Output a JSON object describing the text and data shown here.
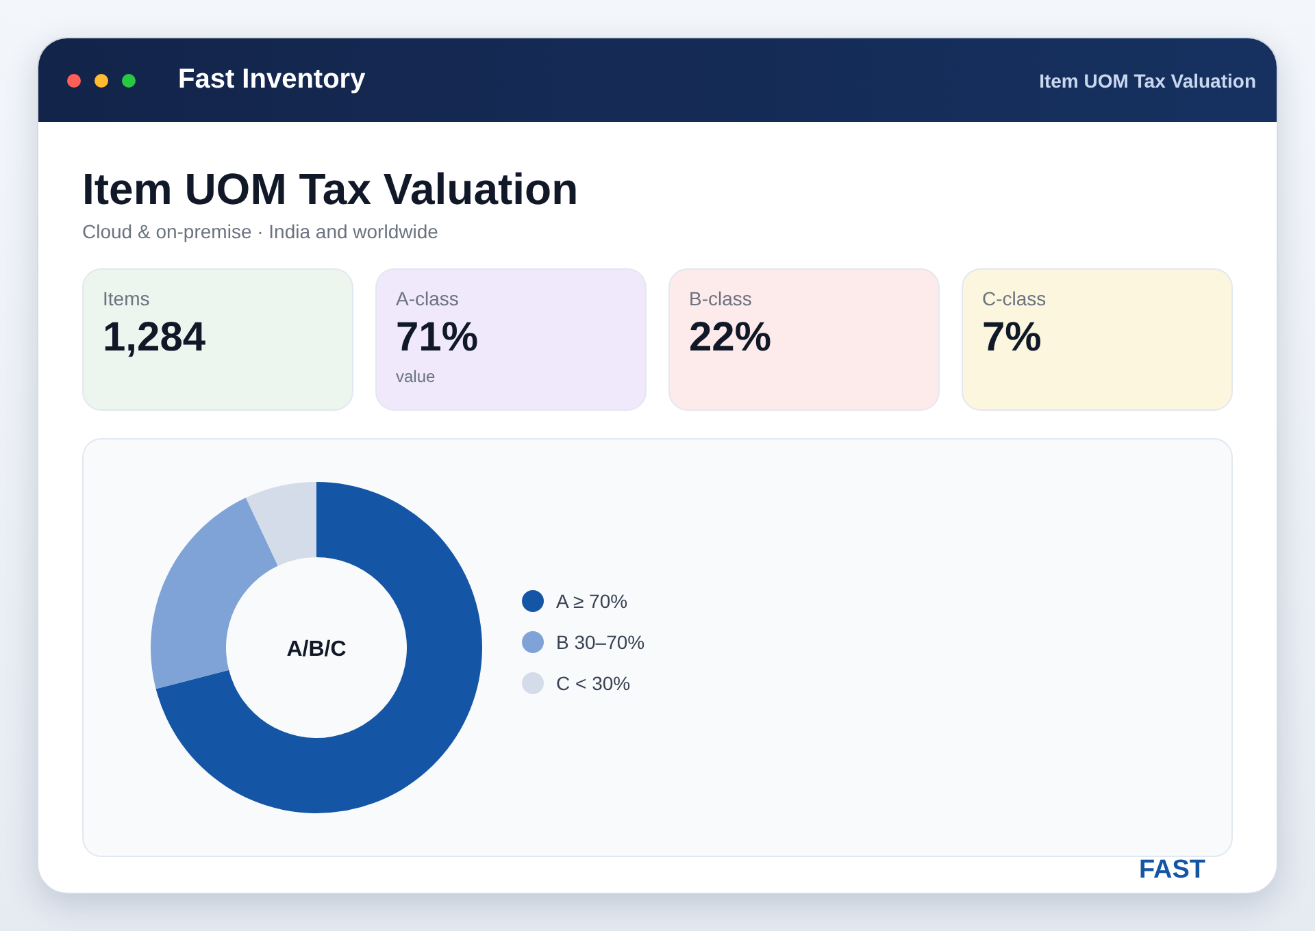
{
  "window": {
    "title": "Fast Inventory",
    "header_label": "Item UOM Tax Valuation"
  },
  "page": {
    "heading": "Item UOM Tax Valuation",
    "subtitle": "Cloud & on-premise · India and worldwide"
  },
  "stats": [
    {
      "label": "Items",
      "value": "1,284",
      "color": "#ecf5ee"
    },
    {
      "label": "A-class",
      "value": "71%",
      "note": "value",
      "color": "#efe9fb"
    },
    {
      "label": "B-class",
      "value": "22%",
      "color": "#fdeaea"
    },
    {
      "label": "C-class",
      "value": "7%",
      "color": "#fcf6df"
    }
  ],
  "chart": {
    "chart_data": {
      "type": "donut",
      "title": "A/B/C",
      "categories": [
        "A ≥ 70%",
        "B 30–70%",
        "C < 30%"
      ],
      "values": [
        71,
        22,
        7
      ],
      "legend": "right"
    },
    "swatches": [
      {
        "color": "#1456a5"
      },
      {
        "color": "#7fa3d6"
      },
      {
        "color": "#d3dce8"
      }
    ]
  },
  "footer": {
    "brand": "FAST"
  }
}
